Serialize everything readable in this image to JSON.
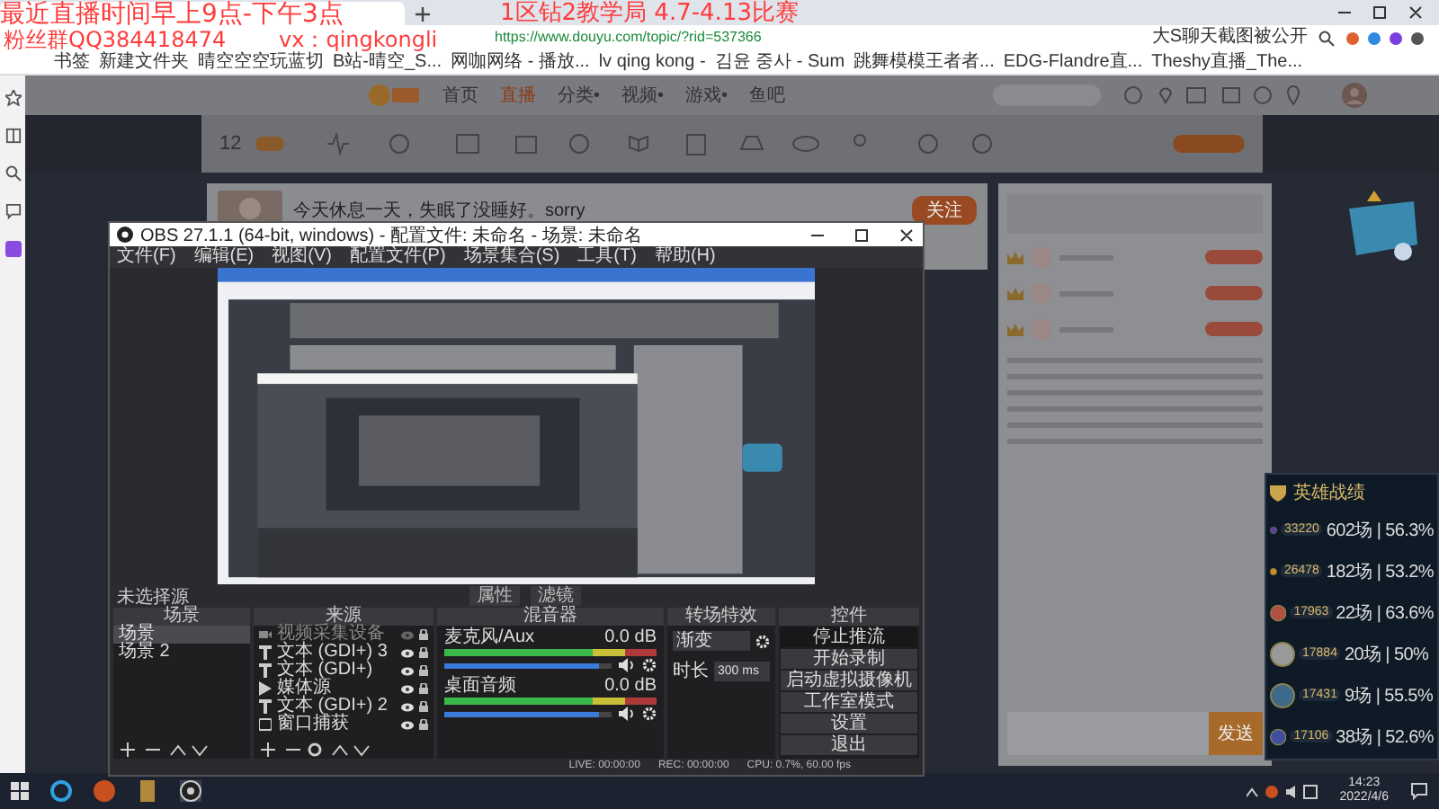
{
  "overlay_text": {
    "schedule": "最近直播时间早上9点-下午3点",
    "event": "1区钻2教学局 4.7-4.13比赛",
    "fan_group": "粉丝群QQ384418474",
    "wechat": "vx：qingkongli"
  },
  "browser": {
    "url": "https://www.douyu.com/topic/?rid=537366",
    "news": "大S聊天截图被公开",
    "bookmarks": [
      "书签",
      "新建文件夹",
      "晴空空空玩蓝切",
      "B站-晴空_S...",
      "网咖网络 - 播放...",
      "lv qing kong -",
      "김윤 중사 - Sum",
      "跳舞模模王者者...",
      "EDG-Flandre直...",
      "Theshy直播_The..."
    ]
  },
  "site": {
    "nav": [
      {
        "label": "首页",
        "selected": false
      },
      {
        "label": "直播",
        "selected": true
      },
      {
        "label": "分类•",
        "selected": false
      },
      {
        "label": "视频•",
        "selected": false
      },
      {
        "label": "游戏•",
        "selected": false
      },
      {
        "label": "鱼吧",
        "selected": false
      }
    ],
    "toolbar_count": "12",
    "stream_title": "今天休息一天，失眠了没睡好。sorry",
    "follow": "关注",
    "send": "发送"
  },
  "obs": {
    "title": "OBS 27.1.1 (64-bit, windows) - 配置文件: 未命名 - 场景: 未命名",
    "menu": [
      "文件(F)",
      "编辑(E)",
      "视图(V)",
      "配置文件(P)",
      "场景集合(S)",
      "工具(T)",
      "帮助(H)"
    ],
    "no_source": "未选择源",
    "source_buttons": [
      "属性",
      "滤镜"
    ],
    "docks": [
      "场景",
      "来源",
      "混音器",
      "转场特效",
      "控件"
    ],
    "scenes": [
      {
        "name": "场景",
        "selected": true
      },
      {
        "name": "场景 2",
        "selected": false
      }
    ],
    "sources": [
      {
        "name": "视频采集设备",
        "kind": "camera",
        "visible": false
      },
      {
        "name": "文本 (GDI+) 3",
        "kind": "text",
        "visible": true
      },
      {
        "name": "文本 (GDI+)",
        "kind": "text",
        "visible": true
      },
      {
        "name": "媒体源",
        "kind": "media",
        "visible": true
      },
      {
        "name": "文本 (GDI+) 2",
        "kind": "text",
        "visible": true
      },
      {
        "name": "窗口捕获",
        "kind": "window",
        "visible": true
      }
    ],
    "mixer": [
      {
        "name": "麦克风/Aux",
        "reading": "0.0 dB",
        "level": 0.93
      },
      {
        "name": "桌面音频",
        "reading": "0.0 dB",
        "level": 0.93
      }
    ],
    "transition": {
      "type": "渐变",
      "duration_label": "时长",
      "duration": "300 ms"
    },
    "controls": [
      {
        "label": "停止推流",
        "selected": true
      },
      {
        "label": "开始录制",
        "selected": false
      },
      {
        "label": "启动虚拟摄像机",
        "selected": false
      },
      {
        "label": "工作室模式",
        "selected": false
      },
      {
        "label": "设置",
        "selected": false
      },
      {
        "label": "退出",
        "selected": false
      }
    ],
    "status": {
      "live": "LIVE: 00:00:00",
      "rec": "REC: 00:00:00",
      "cpu": "CPU: 0.7%, 60.00 fps"
    }
  },
  "heroes": {
    "title": "英雄战绩",
    "rows": [
      {
        "score": "33220",
        "record": "602场 | 56.3%",
        "color": "#5b3f9e"
      },
      {
        "score": "26478",
        "record": "182场 | 53.2%",
        "color": "#c98a2a"
      },
      {
        "score": "17963",
        "record": "22场 | 63.6%",
        "color": "#b0503e"
      },
      {
        "score": "17884",
        "record": "20场 | 50%",
        "color": "#9a9a9a"
      },
      {
        "score": "17431",
        "record": "9场 | 55.5%",
        "color": "#3d6a8a"
      },
      {
        "score": "17106",
        "record": "38场 | 52.6%",
        "color": "#3d4f9e"
      }
    ]
  },
  "taskbar": {
    "time": "14:23",
    "date": "2022/4/6"
  }
}
